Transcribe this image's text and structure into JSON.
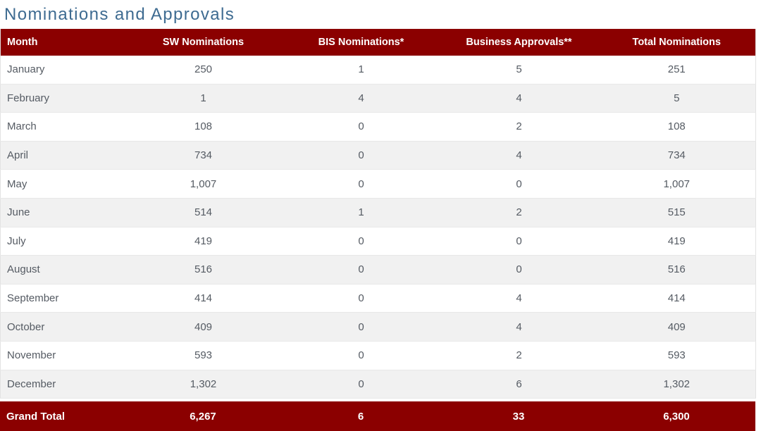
{
  "page": {
    "title": "Nominations and Approvals"
  },
  "theme": {
    "header_bg": "#8B0000",
    "header_text": "#FFFFFF",
    "title_color": "#3E6B91",
    "body_text": "#555B63",
    "row_alt_bg": "#F1F1F1",
    "row_bg": "#FFFFFF",
    "border": "#E8E8E8"
  },
  "table": {
    "columns": [
      {
        "key": "month",
        "label": "Month",
        "align": "left"
      },
      {
        "key": "sw",
        "label": "SW Nominations",
        "align": "center"
      },
      {
        "key": "bis",
        "label": "BIS Nominations*",
        "align": "center"
      },
      {
        "key": "business",
        "label": "Business Approvals**",
        "align": "center"
      },
      {
        "key": "total",
        "label": "Total Nominations",
        "align": "center"
      }
    ],
    "rows": [
      {
        "month": "January",
        "sw": "250",
        "bis": "1",
        "business": "5",
        "total": "251"
      },
      {
        "month": "February",
        "sw": "1",
        "bis": "4",
        "business": "4",
        "total": "5"
      },
      {
        "month": "March",
        "sw": "108",
        "bis": "0",
        "business": "2",
        "total": "108"
      },
      {
        "month": "April",
        "sw": "734",
        "bis": "0",
        "business": "4",
        "total": "734"
      },
      {
        "month": "May",
        "sw": "1,007",
        "bis": "0",
        "business": "0",
        "total": "1,007"
      },
      {
        "month": "June",
        "sw": "514",
        "bis": "1",
        "business": "2",
        "total": "515"
      },
      {
        "month": "July",
        "sw": "419",
        "bis": "0",
        "business": "0",
        "total": "419"
      },
      {
        "month": "August",
        "sw": "516",
        "bis": "0",
        "business": "0",
        "total": "516"
      },
      {
        "month": "September",
        "sw": "414",
        "bis": "0",
        "business": "4",
        "total": "414"
      },
      {
        "month": "October",
        "sw": "409",
        "bis": "0",
        "business": "4",
        "total": "409"
      },
      {
        "month": "November",
        "sw": "593",
        "bis": "0",
        "business": "2",
        "total": "593"
      },
      {
        "month": "December",
        "sw": "1,302",
        "bis": "0",
        "business": "6",
        "total": "1,302"
      }
    ],
    "grand_total": {
      "month": "Grand Total",
      "sw": "6,267",
      "bis": "6",
      "business": "33",
      "total": "6,300"
    }
  },
  "chart_data": {
    "type": "table",
    "title": "Nominations and Approvals",
    "columns": [
      "Month",
      "SW Nominations",
      "BIS Nominations*",
      "Business Approvals**",
      "Total Nominations"
    ],
    "categories": [
      "January",
      "February",
      "March",
      "April",
      "May",
      "June",
      "July",
      "August",
      "September",
      "October",
      "November",
      "December"
    ],
    "series": [
      {
        "name": "SW Nominations",
        "values": [
          250,
          1,
          108,
          734,
          1007,
          514,
          419,
          516,
          414,
          409,
          593,
          1302
        ]
      },
      {
        "name": "BIS Nominations*",
        "values": [
          1,
          4,
          0,
          0,
          0,
          1,
          0,
          0,
          0,
          0,
          0,
          0
        ]
      },
      {
        "name": "Business Approvals**",
        "values": [
          5,
          4,
          2,
          4,
          0,
          2,
          0,
          0,
          4,
          4,
          2,
          6
        ]
      },
      {
        "name": "Total Nominations",
        "values": [
          251,
          5,
          108,
          734,
          1007,
          515,
          419,
          516,
          414,
          409,
          593,
          1302
        ]
      }
    ],
    "totals": {
      "SW Nominations": 6267,
      "BIS Nominations*": 6,
      "Business Approvals**": 33,
      "Total Nominations": 6300
    },
    "total_label": "Grand Total"
  }
}
